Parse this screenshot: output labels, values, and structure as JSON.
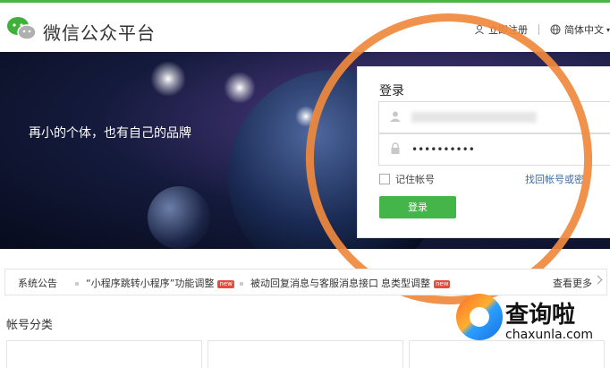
{
  "header": {
    "brand": "微信公众平台",
    "register": "立即注册",
    "language": "简体中文"
  },
  "hero": {
    "slogan": "再小的个体，也有自己的品牌"
  },
  "login": {
    "title": "登录",
    "password_value": "••••••••••",
    "remember": "记住帐号",
    "forgot": "找回帐号或密",
    "submit": "登录"
  },
  "notice": {
    "label": "系统公告",
    "items": [
      {
        "text": "“小程序跳转小程序”功能调整",
        "badge": "new"
      },
      {
        "text": "被动回复消息与客服消息接口",
        "badge": ""
      },
      {
        "text": "息类型调整",
        "badge": "new"
      }
    ],
    "more": "查看更多"
  },
  "section": {
    "title": "帐号分类"
  },
  "watermark": {
    "text": "查询啦",
    "url": "chaxunla.com"
  },
  "colors": {
    "accent_green": "#44b549",
    "annotation_orange": "#f0893d",
    "link_blue": "#3a6ea5"
  }
}
